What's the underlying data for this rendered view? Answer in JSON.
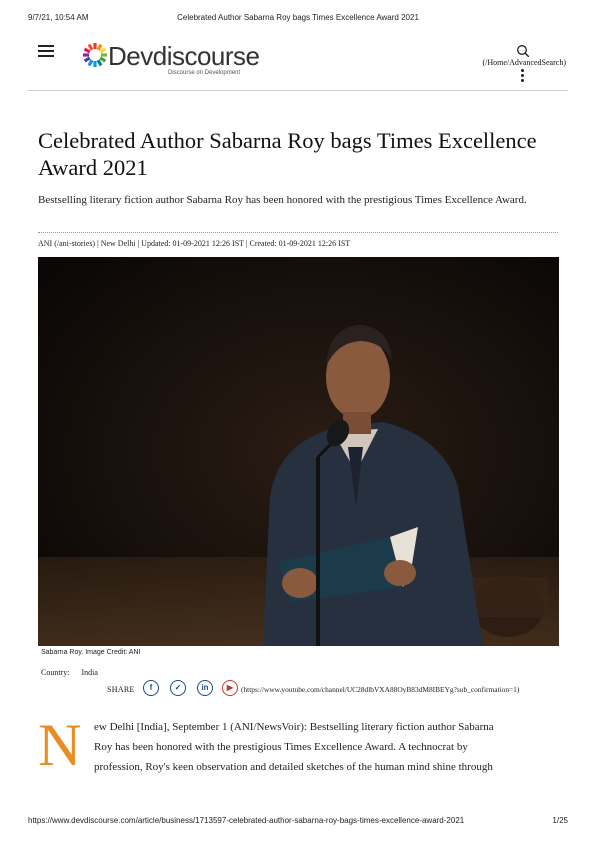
{
  "print_header": {
    "datetime": "9/7/21, 10:54 AM",
    "title": "Celebrated Author Sabarna Roy bags Times Excellence Award 2021"
  },
  "site": {
    "logo_text": "Devdiscourse",
    "logo_tagline": "Discourse on Development",
    "search_link": "(/Home/AdvancedSearch)"
  },
  "article": {
    "headline": "Celebrated Author Sabarna Roy bags Times Excellence Award 2021",
    "subheadline": "Bestselling literary fiction author Sabarna Roy has been honored with the prestigious Times Excellence Award.",
    "byline": "ANI (/ani-stories) | New Delhi | Updated: 01-09-2021 12:26 IST | Created: 01-09-2021 12:26 IST",
    "image_caption": "Sabarna Roy. Image Credit: ANI",
    "country_label": "Country:",
    "country_value": "India",
    "share_label": "SHARE",
    "share_icons": [
      "facebook-icon",
      "twitter-icon",
      "linkedin-icon",
      "youtube-icon"
    ],
    "youtube_url": "(https://www.youtube.com/channel/UC28dlbVXA88OyB83dM8IBEYg?sub_confirmation=1)",
    "dropcap": "N",
    "body_lines": [
      "ew Delhi [India], September 1 (ANI/NewsVoir): Bestselling literary fiction author Sabarna",
      "Roy has been honored with the prestigious Times Excellence Award. A technocrat by",
      "profession, Roy's keen observation and detailed sketches of the human mind shine through"
    ]
  },
  "print_footer": {
    "url": "https://www.devdiscourse.com/article/business/1713597-celebrated-author-sabarna-roy-bags-times-excellence-award-2021",
    "page": "1/25"
  },
  "colors": {
    "dropcap": "#e88d22",
    "share_blue": "#1a4a8a",
    "youtube_red": "#c0392b"
  }
}
